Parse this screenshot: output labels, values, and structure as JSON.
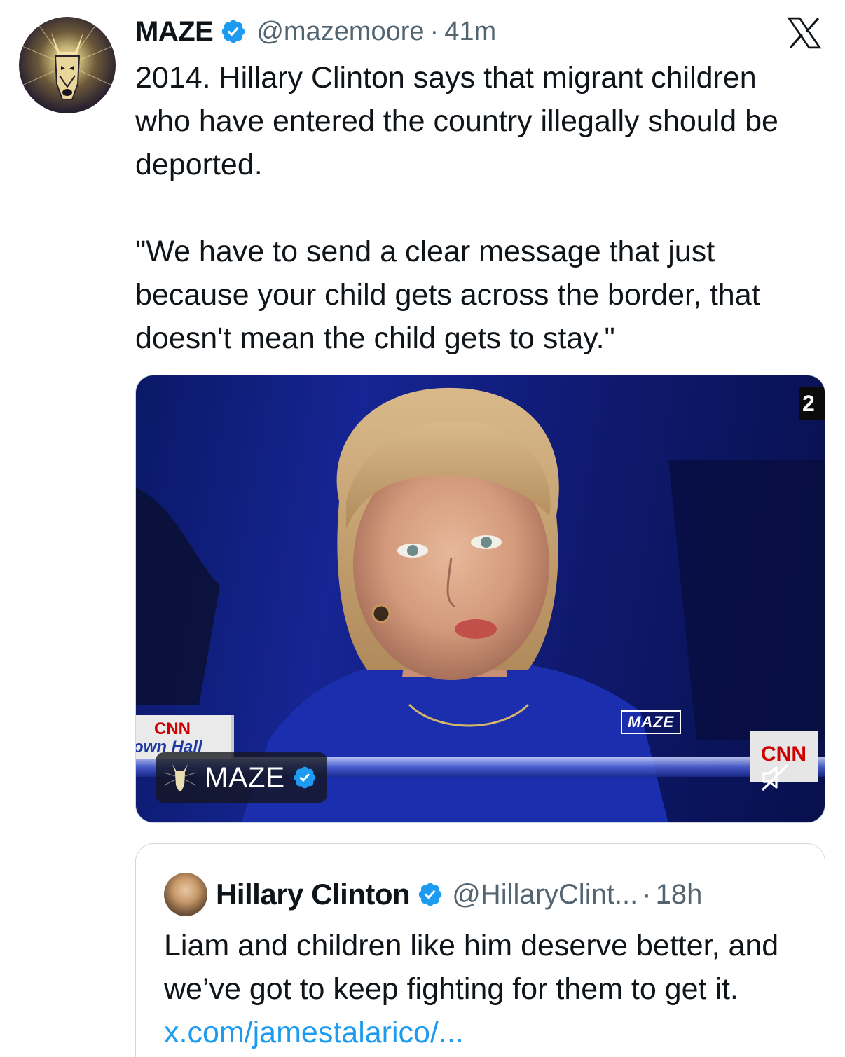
{
  "tweet": {
    "author_name": "MAZE",
    "handle": "@mazemoore",
    "separator": "·",
    "time": "41m",
    "text": "2014. Hillary Clinton says that migrant children who have entered the country illegally should be deported.\n\n\"We have to send a clear message that just because your child gets across the border, that doesn't mean the child gets to stay.\""
  },
  "icons": {
    "verified": "verified-badge-icon",
    "platform_logo": "x-logo-icon",
    "mute": "speaker-muted-icon",
    "accent_color": "#1d9bf0"
  },
  "media": {
    "watermark": "MAZE",
    "chip_name": "MAZE",
    "network_tag": "CNN",
    "network_subtitle": "own Hall",
    "corner_number": "2"
  },
  "quote": {
    "author_name": "Hillary Clinton",
    "handle": "@HillaryClint...",
    "separator": "·",
    "time": "18h",
    "text": "Liam and children like him deserve better, and we’ve got to keep fighting for them to get it. ",
    "link": "x.com/jamestalarico/..."
  }
}
